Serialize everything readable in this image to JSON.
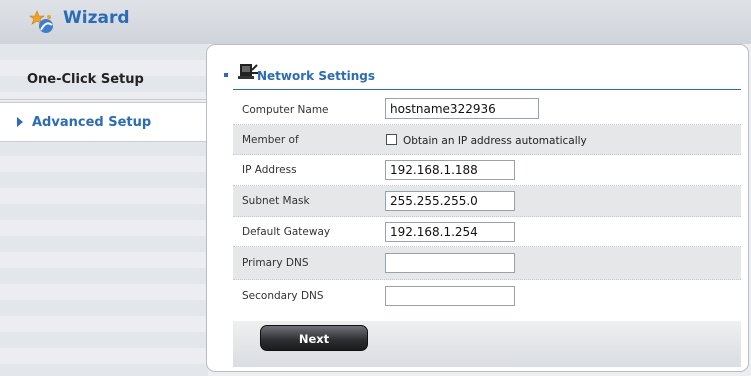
{
  "app": {
    "title": "Wizard"
  },
  "sidebar": {
    "items": [
      {
        "label": "One-Click Setup"
      },
      {
        "label": "Advanced Setup"
      }
    ]
  },
  "section": {
    "title": "Network Settings"
  },
  "form": {
    "computer_name_label": "Computer Name",
    "computer_name_value": "hostname322936",
    "member_of_label": "Member of",
    "obtain_ip_label": "Obtain an IP address automatically",
    "obtain_ip_checked": false,
    "ip_address_label": "IP Address",
    "ip_address_value": "192.168.1.188",
    "subnet_mask_label": "Subnet Mask",
    "subnet_mask_value": "255.255.255.0",
    "default_gateway_label": "Default Gateway",
    "default_gateway_value": "192.168.1.254",
    "primary_dns_label": "Primary DNS",
    "primary_dns_value": "",
    "secondary_dns_label": "Secondary DNS",
    "secondary_dns_value": ""
  },
  "buttons": {
    "next_label": "Next"
  },
  "colors": {
    "accent": "#2a6cb8",
    "shade": "#e6e7e9"
  },
  "icons": {
    "app_icon": "wizard-icon",
    "section_icon": "network-settings-icon",
    "active_marker": "chevron-right-icon"
  }
}
